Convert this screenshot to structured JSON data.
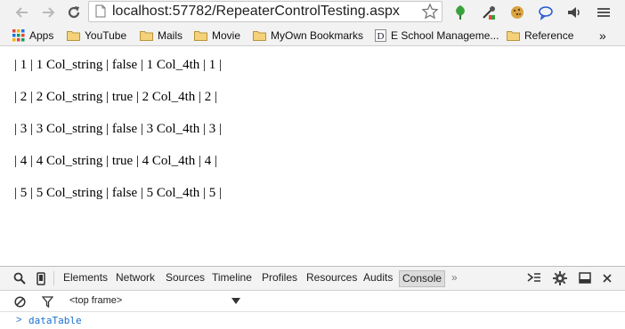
{
  "browser": {
    "url": "localhost:57782/RepeaterControlTesting.aspx"
  },
  "bookmarks": [
    {
      "label": "Apps",
      "icon": "apps-grid-icon"
    },
    {
      "label": "YouTube",
      "icon": "folder-icon"
    },
    {
      "label": "Mails",
      "icon": "folder-icon"
    },
    {
      "label": "Movie",
      "icon": "folder-icon"
    },
    {
      "label": "MyOwn Bookmarks",
      "icon": "folder-icon"
    },
    {
      "label": "E School Manageme...",
      "icon": "page-d-icon"
    },
    {
      "label": "Reference",
      "icon": "folder-icon"
    },
    {
      "label": "»",
      "icon": "overflow-icon"
    }
  ],
  "rows": [
    [
      "| 1 | 1 Col_string | false | 1 Col_4th | 1 |"
    ],
    [
      "| 2 | 2 Col_string | true | 2 Col_4th | 2 |"
    ],
    [
      "| 3 | 3 Col_string | false | 3 Col_4th | 3 |"
    ],
    [
      "| 4 | 4 Col_string | true | 4 Col_4th | 4 |"
    ],
    [
      "| 5 | 5 Col_string | false | 5 Col_4th | 5 |"
    ]
  ],
  "devtools": {
    "tabs": [
      "Elements",
      "Network",
      "Sources",
      "Timeline",
      "Profiles",
      "Resources",
      "Audits",
      "Console"
    ],
    "active_tab": "Console",
    "overflow": "»",
    "frame_selector": "<top frame>",
    "console_prompt": ">",
    "console_input": "dataTable"
  },
  "colors": {
    "chrome_bg": "#f2f2f2",
    "console_text": "#1a6fd0",
    "ext_green": "#3aa23a"
  }
}
